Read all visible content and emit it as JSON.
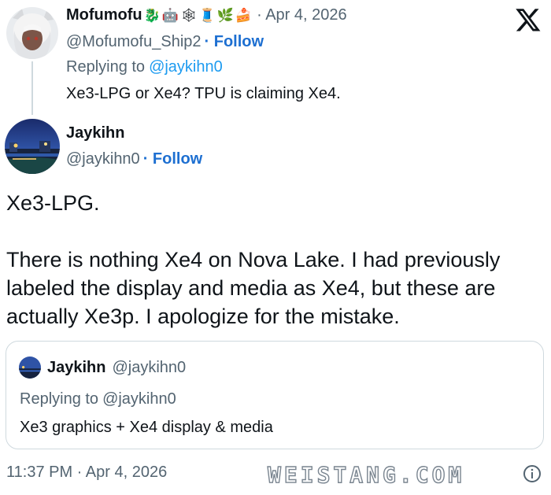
{
  "parent_tweet": {
    "display_name": "Mofumofu",
    "name_emojis": [
      "🐉",
      "🤖",
      "🕸",
      "🧵",
      "🌿",
      "🍰"
    ],
    "date": "· Apr 4, 2026",
    "handle": "@Mofumofu_Ship2",
    "follow_label": "· Follow",
    "replying_prefix": "Replying to",
    "replying_handle": "@jaykihn0",
    "text": "Xe3-LPG or Xe4? TPU is claiming Xe4."
  },
  "main_tweet": {
    "display_name": "Jaykihn",
    "handle": "@jaykihn0",
    "follow_label": "· Follow",
    "text_line1": "Xe3-LPG.",
    "text_line2": "There is nothing Xe4 on Nova Lake. I had previously",
    "text_line3": "labeled the display and media as Xe4, but these are",
    "text_line4": "actually Xe3p. I apologize for the mistake."
  },
  "quoted_tweet": {
    "display_name": "Jaykihn",
    "handle": "@jaykihn0",
    "replying_prefix": "Replying to",
    "replying_handle": "@jaykihn0",
    "text": "Xe3 graphics + Xe4 display & media"
  },
  "footer": {
    "timestamp": "11:37 PM · Apr 4, 2026"
  },
  "watermark": "WEISTANG.COM",
  "icons": [
    "x-logo-icon",
    "info-icon"
  ],
  "colors": {
    "link": "#1d9bf0",
    "follow": "#1d6fd1",
    "muted": "#536471",
    "text": "#0f1419",
    "border": "#cfd9de"
  }
}
